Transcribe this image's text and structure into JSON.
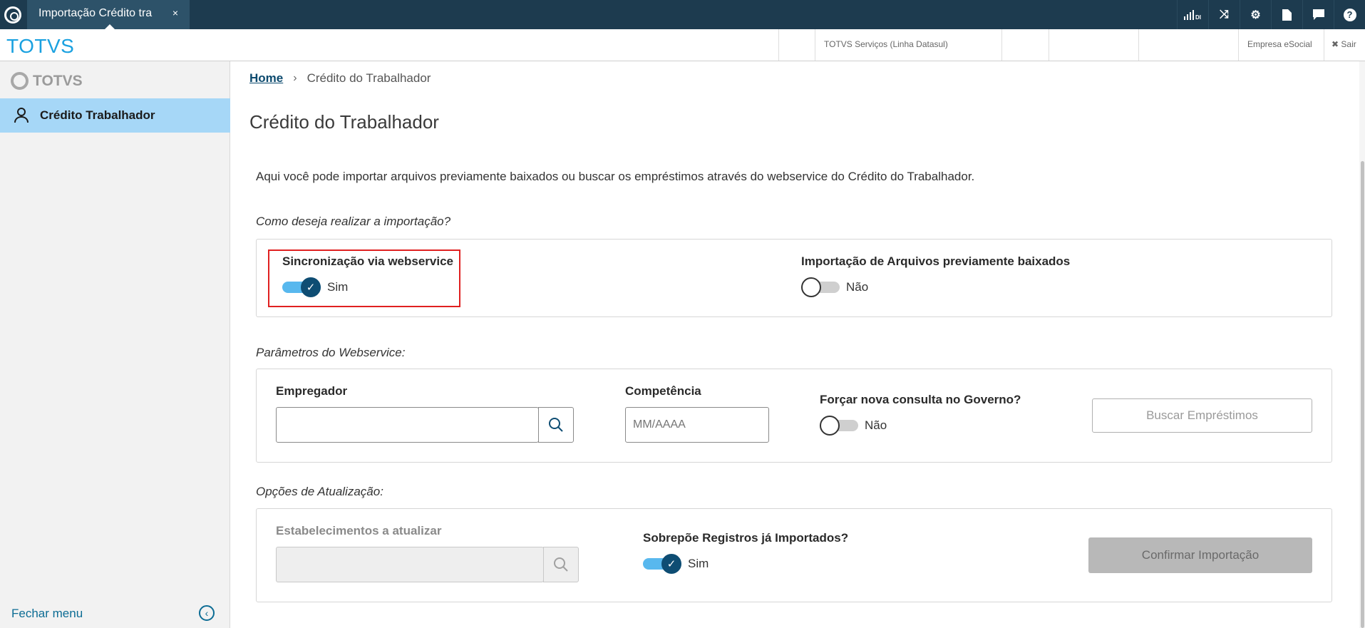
{
  "topbar": {
    "tab_label": "Importação Crédito tra",
    "tab_close": "×",
    "icons": [
      {
        "name": "signal-icon",
        "glyph": "DI"
      },
      {
        "name": "shuffle-icon",
        "glyph": "⤨"
      },
      {
        "name": "gear-icon",
        "glyph": "⚙"
      },
      {
        "name": "document-icon",
        "glyph": "▤"
      },
      {
        "name": "chat-icon",
        "glyph": "▰"
      },
      {
        "name": "help-icon",
        "glyph": "?"
      }
    ]
  },
  "header": {
    "brand": "TOTVS",
    "company": "TOTVS Serviços (Linha Datasul)",
    "esocial": "Empresa eSocial",
    "logout": "✖ Sair"
  },
  "sidebar": {
    "logo_text": "TOTVS",
    "items": [
      {
        "label": "Crédito Trabalhador"
      }
    ],
    "close_menu": "Fechar menu"
  },
  "breadcrumb": {
    "home": "Home",
    "current": "Crédito do Trabalhador"
  },
  "page": {
    "title": "Crédito do Trabalhador",
    "intro": "Aqui você pode importar arquivos previamente baixados ou buscar os empréstimos através do webservice do Crédito do Trabalhador."
  },
  "import_mode": {
    "section_title": "Como deseja realizar a importação?",
    "webservice_label": "Sincronização via webservice",
    "webservice_value": "Sim",
    "files_label": "Importação de Arquivos previamente baixados",
    "files_value": "Não"
  },
  "webservice_params": {
    "section_title": "Parâmetros do Webservice:",
    "employer_label": "Empregador",
    "employer_value": "",
    "competence_label": "Competência",
    "competence_placeholder": "MM/AAAA",
    "force_label": "Forçar nova consulta no Governo?",
    "force_value": "Não",
    "search_button": "Buscar Empréstimos"
  },
  "update_options": {
    "section_title": "Opções de Atualização:",
    "establishments_label": "Estabelecimentos a atualizar",
    "overwrite_label": "Sobrepõe Registros já Importados?",
    "overwrite_value": "Sim",
    "confirm_button": "Confirmar Importação"
  },
  "colors": {
    "topbar": "#1d3b4f",
    "brand": "#1aa1e0",
    "sidebar_active": "#a6d7f7",
    "switch_on": "#0e4d73",
    "highlight": "#e02020"
  }
}
